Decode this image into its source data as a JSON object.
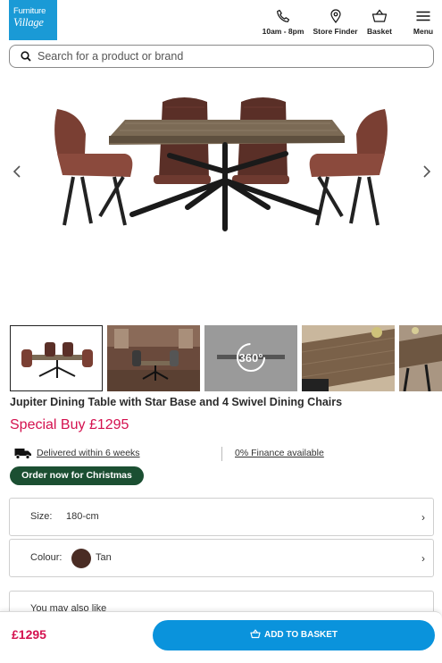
{
  "brand": {
    "line1": "Furniture",
    "line2": "Village"
  },
  "nav": {
    "phone_label": "10am - 8pm",
    "store_label": "Store Finder",
    "basket_label": "Basket",
    "menu_label": "Menu"
  },
  "search": {
    "placeholder": "Search for a product or brand"
  },
  "gallery": {
    "thumb_360_label": "360°"
  },
  "product": {
    "title": "Jupiter Dining Table with Star Base and 4 Swivel Dining Chairs",
    "price_text": "Special Buy £1295",
    "delivery": "Delivered within 6 weeks",
    "finance": "0% Finance available",
    "promo_badge": "Order now for Christmas"
  },
  "options": {
    "size_label": "Size:",
    "size_value": "180-cm",
    "colour_label": "Colour:",
    "colour_value": "Tan",
    "colour_swatch": "#4a2c24"
  },
  "also_like": {
    "title": "You may also like"
  },
  "footer_bar": {
    "price": "£1295",
    "add_to_basket": "ADD TO BASKET"
  },
  "colors": {
    "brand_blue": "#1a9ad6",
    "price_pink": "#d4114f",
    "promo_green": "#1b4f32",
    "button_blue": "#0a93dc"
  }
}
